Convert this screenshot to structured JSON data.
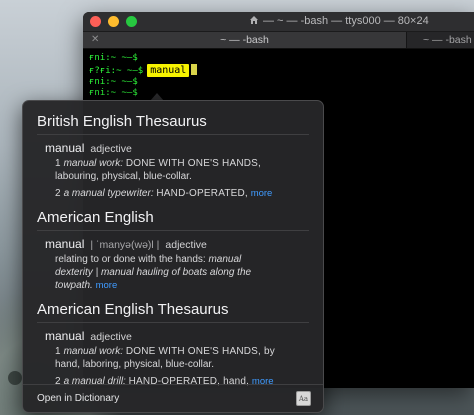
{
  "window": {
    "title": "— ~ — -bash — ttys000 — 80×24",
    "tabs": [
      {
        "label": "~ — -bash",
        "active": true
      },
      {
        "label": "~ — -bash",
        "active": false
      }
    ]
  },
  "terminal": {
    "garbled_lines": [
      "ғnі:~ ~—$",
      "ғ?ғі:~ ~—$",
      "ғnі:~ ~—$",
      "ғnі:~ ~—$"
    ],
    "selected_word": "manual"
  },
  "popover": {
    "sections": [
      {
        "title": "British English Thesaurus",
        "headword": "manual",
        "pos": "adjective",
        "pron": "",
        "senses": [
          {
            "num": "1",
            "example": "manual work:",
            "text": "DONE WITH ONE'S HANDS,",
            "cont": "labouring, physical, blue-collar."
          },
          {
            "num": "2",
            "example": "a manual typewriter:",
            "text": "HAND-OPERATED,",
            "more": "more"
          }
        ]
      },
      {
        "title": "American English",
        "headword": "manual",
        "pos": "adjective",
        "pron": "| ˈmanyə(wə)l |",
        "senses": [
          {
            "num": "",
            "text": "relating to or done with the hands:",
            "example": "manual",
            "cont": "dexterity",
            "cont2": "| manual hauling of boats along the",
            "cont3": "towpath.",
            "more": "more"
          }
        ]
      },
      {
        "title": "American English Thesaurus",
        "headword": "manual",
        "pos": "adjective",
        "pron": "",
        "senses": [
          {
            "num": "1",
            "example": "manual work:",
            "text": "DONE WITH ONE'S HANDS, by",
            "cont": "hand, laboring, physical, blue-collar."
          },
          {
            "num": "2",
            "example": "a manual drill:",
            "text": "HAND-OPERATED, hand,",
            "more": "more"
          }
        ]
      }
    ],
    "footer_label": "Open in Dictionary",
    "footer_icon": "dictionary-app-icon"
  }
}
